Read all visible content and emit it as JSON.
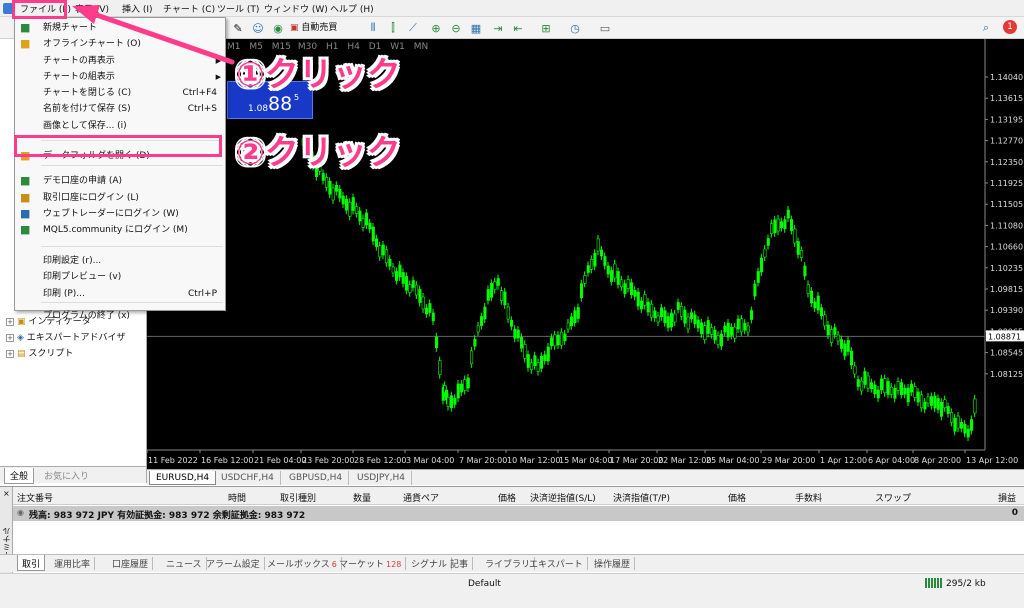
{
  "menubar": {
    "items": [
      "ファイル (F)",
      "表示 (V)",
      "挿入 (I)",
      "チャート (C)",
      "ツール (T)",
      "ウィンドウ (W)",
      "ヘルプ (H)"
    ]
  },
  "toolbar": {
    "autotrade_label": "自動売買",
    "timeframes": [
      "M1",
      "M5",
      "M15",
      "M30",
      "H1",
      "H4",
      "D1",
      "W1",
      "MN"
    ],
    "notification_count": "1"
  },
  "file_menu": {
    "items": [
      {
        "label": "新規チャート",
        "shortcut": "",
        "submenu": false
      },
      {
        "label": "オフラインチャート (O)",
        "shortcut": "",
        "submenu": false
      },
      {
        "label": "チャートの再表示",
        "shortcut": "",
        "submenu": true
      },
      {
        "label": "チャートの組表示",
        "shortcut": "",
        "submenu": true
      },
      {
        "label": "チャートを閉じる (C)",
        "shortcut": "Ctrl+F4",
        "submenu": false
      },
      {
        "label": "名前を付けて保存 (S)",
        "shortcut": "Ctrl+S",
        "submenu": false
      },
      {
        "label": "画像として保存... (i)",
        "shortcut": "",
        "submenu": false
      },
      {
        "label": "データフォルダを開く (D)",
        "shortcut": "",
        "submenu": false
      },
      {
        "label": "デモ口座の申請 (A)",
        "shortcut": "",
        "submenu": false
      },
      {
        "label": "取引口座にログイン (L)",
        "shortcut": "",
        "submenu": false
      },
      {
        "label": "ウェブトレーダーにログイン (W)",
        "shortcut": "",
        "submenu": false
      },
      {
        "label": "MQL5.community にログイン (M)",
        "shortcut": "",
        "submenu": false
      },
      {
        "label": "印刷設定 (r)...",
        "shortcut": "",
        "submenu": false
      },
      {
        "label": "印刷プレビュー (v)",
        "shortcut": "",
        "submenu": false
      },
      {
        "label": "印刷 (P)...",
        "shortcut": "Ctrl+P",
        "submenu": false
      },
      {
        "label": "プログラムの終了 (x)",
        "shortcut": "",
        "submenu": false
      }
    ]
  },
  "annotations": {
    "step1": "①クリック",
    "step2": "②クリック"
  },
  "quote_panel": {
    "price_small": "1.08",
    "price_big": "88",
    "price_sup": "5"
  },
  "navigator": {
    "items": [
      "インディケータ",
      "エキスパートアドバイザ",
      "スクリプト"
    ],
    "tabs": [
      "全般",
      "お気に入り"
    ]
  },
  "chart": {
    "price_labels": [
      "1.14040",
      "1.13615",
      "1.13195",
      "1.12770",
      "1.12350",
      "1.11925",
      "1.11505",
      "1.11080",
      "1.10660",
      "1.10235",
      "1.09815",
      "1.09390",
      "1.08965",
      "1.08545",
      "1.08125"
    ],
    "current_price": "1.08871",
    "date_labels": [
      "11 Feb 2022",
      "16 Feb 12:00",
      "21 Feb 04:00",
      "23 Feb 20:00",
      "28 Feb 12:00",
      "3 Mar 04:00",
      "7 Mar 20:00",
      "10 Mar 12:00",
      "15 Mar 04:00",
      "17 Mar 20:00",
      "22 Mar 12:00",
      "25 Mar 04:00",
      "29 Mar 20:00",
      "1 Apr 12:00",
      "6 Apr 04:00",
      "8 Apr 20:00",
      "13 Apr 12:00"
    ]
  },
  "chart_tabs": [
    "EURUSD,H4",
    "USDCHF,H4",
    "GBPUSD,H4",
    "USDJPY,H4"
  ],
  "terminal": {
    "side_label": "ターミナル",
    "columns": [
      "注文番号",
      "時間",
      "取引種別",
      "数量",
      "通貨ペア",
      "価格",
      "決済逆指値(S/L)",
      "決済指値(T/P)",
      "価格",
      "手数料",
      "スワップ",
      "損益"
    ],
    "balance_text": "残高: 983 972 JPY  有効証拠金: 983 972  余剰証拠金: 983 972",
    "balance_value": "0",
    "tabs": [
      {
        "label": "取引",
        "badge": ""
      },
      {
        "label": "運用比率",
        "badge": ""
      },
      {
        "label": "口座履歴",
        "badge": ""
      },
      {
        "label": "ニュース",
        "badge": ""
      },
      {
        "label": "アラーム設定",
        "badge": ""
      },
      {
        "label": "メールボックス",
        "badge": "6"
      },
      {
        "label": "マーケット",
        "badge": "128"
      },
      {
        "label": "シグナル",
        "badge": ""
      },
      {
        "label": "記事",
        "badge": ""
      },
      {
        "label": "ライブラリ",
        "badge": ""
      },
      {
        "label": "エキスパート",
        "badge": ""
      },
      {
        "label": "操作履歴",
        "badge": ""
      }
    ]
  },
  "status": {
    "profile": "Default",
    "traffic": "295/2 kb"
  },
  "colors": {
    "accent": "#ff3c8c",
    "candle": "#00ff00",
    "chart_bg": "#000000"
  }
}
